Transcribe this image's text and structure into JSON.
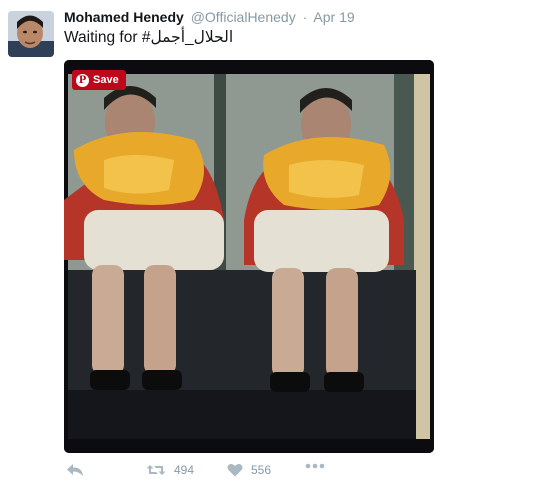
{
  "tweet": {
    "author_name": "Mohamed Henedy",
    "handle": "@OfficialHenedy",
    "separator": "·",
    "timestamp": "Apr 19",
    "text_prefix": "Waiting for",
    "hashtag": "الحلال_أجمل#"
  },
  "media": {
    "save_label": "Save"
  },
  "actions": {
    "retweet_count": "494",
    "like_count": "556"
  },
  "colors": {
    "pinterest_red": "#bd081c",
    "icon_gray": "#aab8c2",
    "meta_gray": "#8899a6"
  },
  "icons": [
    "reply-icon",
    "retweet-icon",
    "heart-icon",
    "more-icon",
    "pinterest-icon"
  ]
}
